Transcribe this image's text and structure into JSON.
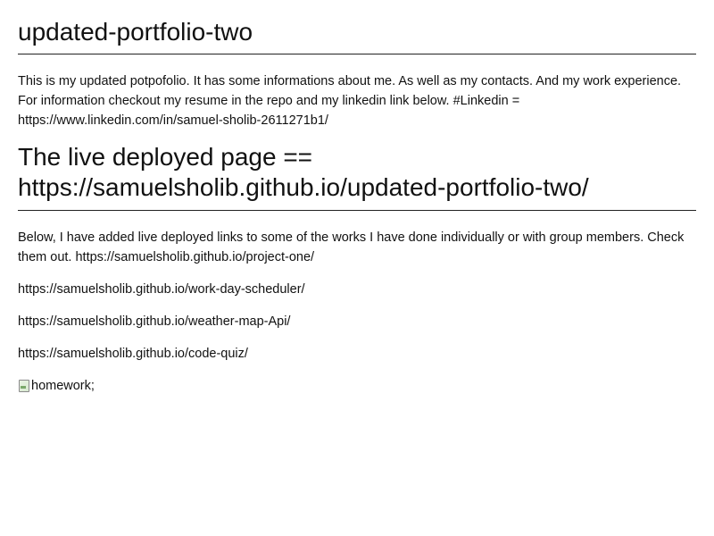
{
  "title": "updated-portfolio-two",
  "intro": "This is my updated potpofolio. It has some informations about me. As well as my contacts. And my work experience. For information checkout my resume in the repo and my linkedin link below. #Linkedin = https://www.linkedin.com/in/samuel-sholib-2611271b1/",
  "deployed_heading": "The live deployed page == https://samuelsholib.github.io/updated-portfolio-two/",
  "works_paragraph": "Below, I have added live deployed links to some of the works I have done individually or with group members. Check them out. https://samuelsholib.github.io/project-one/",
  "links": [
    "https://samuelsholib.github.io/work-day-scheduler/",
    "https://samuelsholib.github.io/weather-map-Api/",
    "https://samuelsholib.github.io/code-quiz/"
  ],
  "image_alt": "homework;"
}
